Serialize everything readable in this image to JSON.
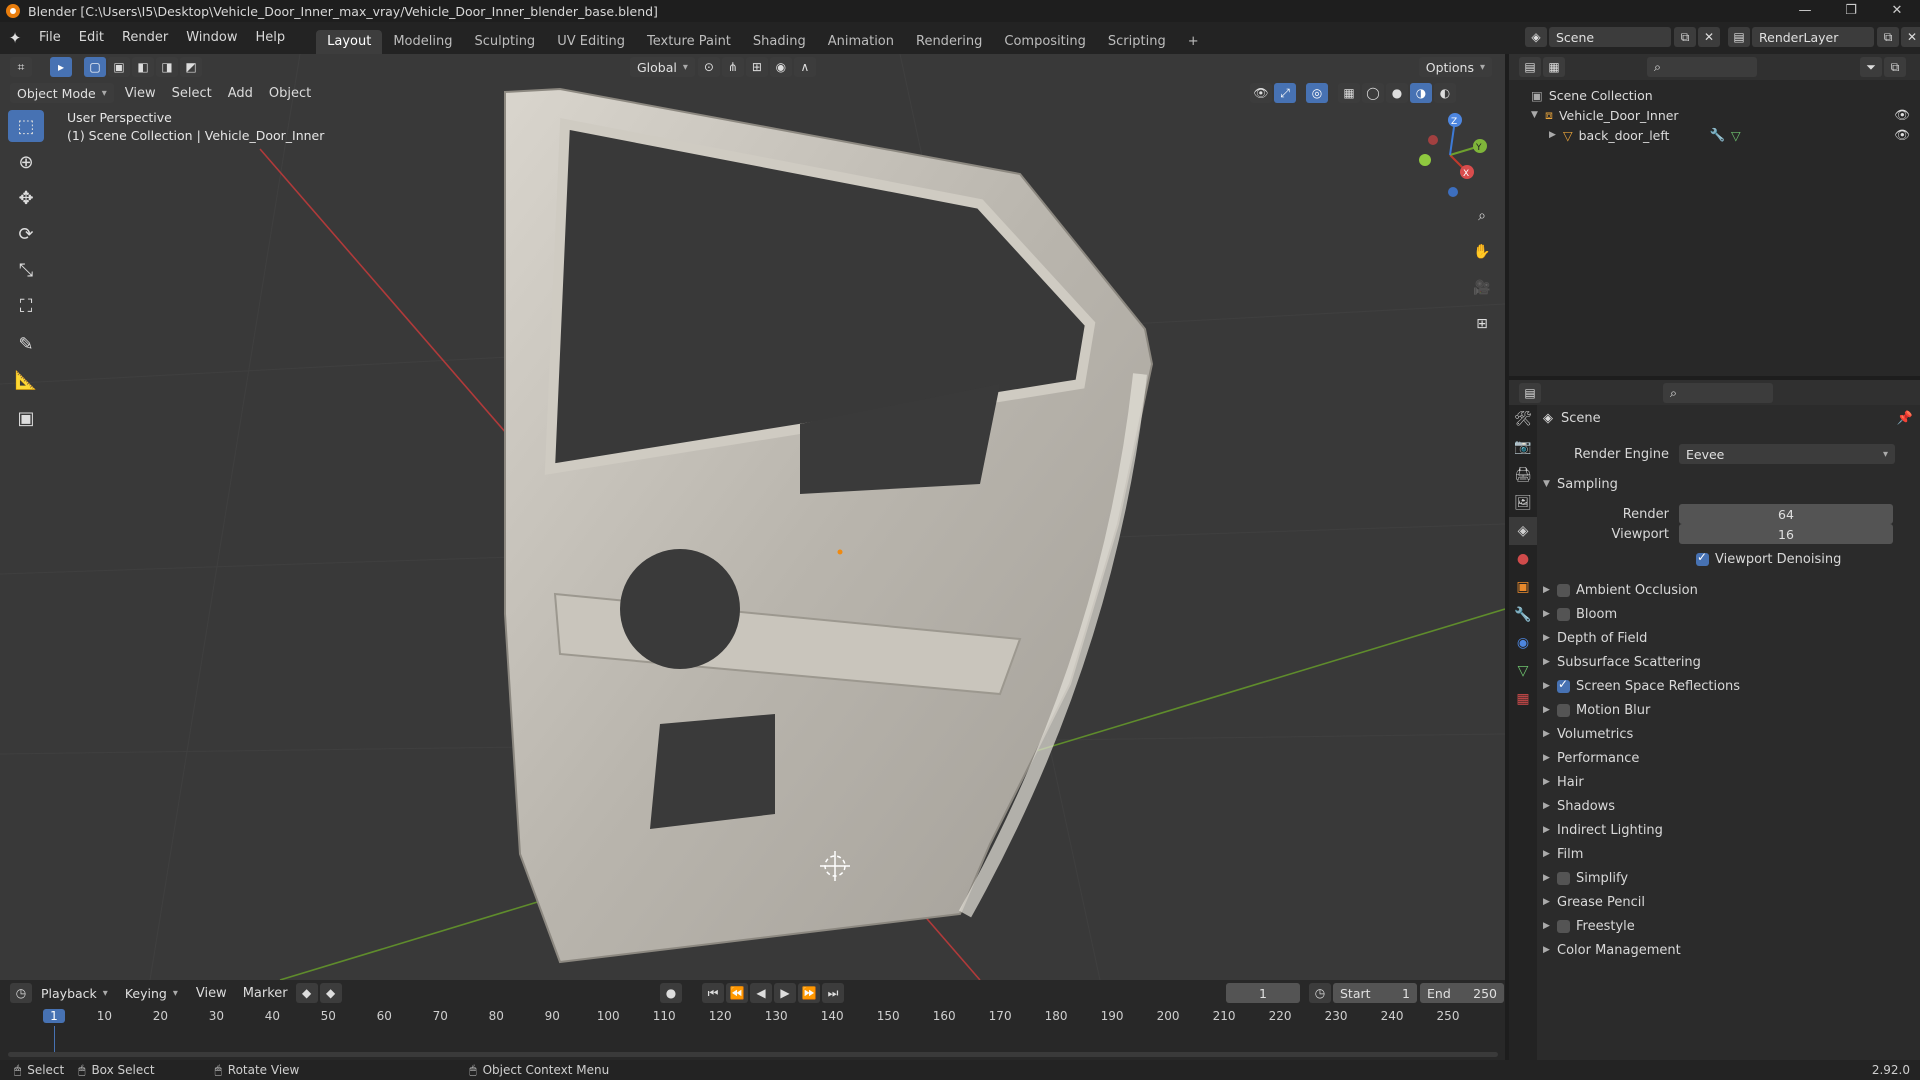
{
  "titlebar": {
    "title": "Blender [C:\\Users\\I5\\Desktop\\Vehicle_Door_Inner_max_vray/Vehicle_Door_Inner_blender_base.blend]",
    "win_min": "—",
    "win_max": "❐",
    "win_close": "✕"
  },
  "menus": [
    "File",
    "Edit",
    "Render",
    "Window",
    "Help"
  ],
  "workspaces": [
    "Layout",
    "Modeling",
    "Sculpting",
    "UV Editing",
    "Texture Paint",
    "Shading",
    "Animation",
    "Rendering",
    "Compositing",
    "Scripting"
  ],
  "workspace_add": "+",
  "scene_selector": "Scene",
  "layer_selector": "RenderLayer",
  "viewport": {
    "mode": "Object Mode",
    "menus": [
      "View",
      "Select",
      "Add",
      "Object"
    ],
    "transform": "Global",
    "options": "Options",
    "perspective": "User Perspective",
    "collection_info": "(1) Scene Collection | Vehicle_Door_Inner",
    "gizmo": {
      "x": "X",
      "y": "Y",
      "z": "Z"
    }
  },
  "outliner": {
    "root": "Scene Collection",
    "items": [
      {
        "label": "Vehicle_Door_Inner"
      },
      {
        "label": "back_door_left"
      }
    ]
  },
  "properties": {
    "context": "Scene",
    "render_engine_label": "Render Engine",
    "render_engine": "Eevee",
    "sampling": "Sampling",
    "render_label": "Render",
    "render_value": "64",
    "viewport_label": "Viewport",
    "viewport_value": "16",
    "viewport_denoising": "Viewport Denoising",
    "sections": [
      {
        "label": "Ambient Occlusion",
        "checkbox": true,
        "checked": false
      },
      {
        "label": "Bloom",
        "checkbox": true,
        "checked": false
      },
      {
        "label": "Depth of Field",
        "checkbox": false
      },
      {
        "label": "Subsurface Scattering",
        "checkbox": false
      },
      {
        "label": "Screen Space Reflections",
        "checkbox": true,
        "checked": true
      },
      {
        "label": "Motion Blur",
        "checkbox": true,
        "checked": false
      },
      {
        "label": "Volumetrics",
        "checkbox": false
      },
      {
        "label": "Performance",
        "checkbox": false
      },
      {
        "label": "Hair",
        "checkbox": false
      },
      {
        "label": "Shadows",
        "checkbox": false
      },
      {
        "label": "Indirect Lighting",
        "checkbox": false
      },
      {
        "label": "Film",
        "checkbox": false
      },
      {
        "label": "Simplify",
        "checkbox": true,
        "checked": false
      },
      {
        "label": "Grease Pencil",
        "checkbox": false
      },
      {
        "label": "Freestyle",
        "checkbox": true,
        "checked": false
      },
      {
        "label": "Color Management",
        "checkbox": false
      }
    ]
  },
  "timeline": {
    "menus": [
      "Playback",
      "Keying",
      "View",
      "Marker"
    ],
    "current_frame": "1",
    "start_label": "Start",
    "start": "1",
    "end_label": "End",
    "end": "250",
    "ticks": [
      "1",
      "10",
      "20",
      "30",
      "40",
      "50",
      "60",
      "70",
      "80",
      "90",
      "100",
      "110",
      "120",
      "130",
      "140",
      "150",
      "160",
      "170",
      "180",
      "190",
      "200",
      "210",
      "220",
      "230",
      "240",
      "250"
    ]
  },
  "statusbar": {
    "select": "Select",
    "box_select": "Box Select",
    "rotate_view": "Rotate View",
    "context_menu": "Object Context Menu",
    "version": "2.92.0"
  },
  "colors": {
    "accent": "#4772b3",
    "x_axis": "#c0392b",
    "y_axis": "#6ea02e",
    "z_axis": "#3d7ad6"
  }
}
